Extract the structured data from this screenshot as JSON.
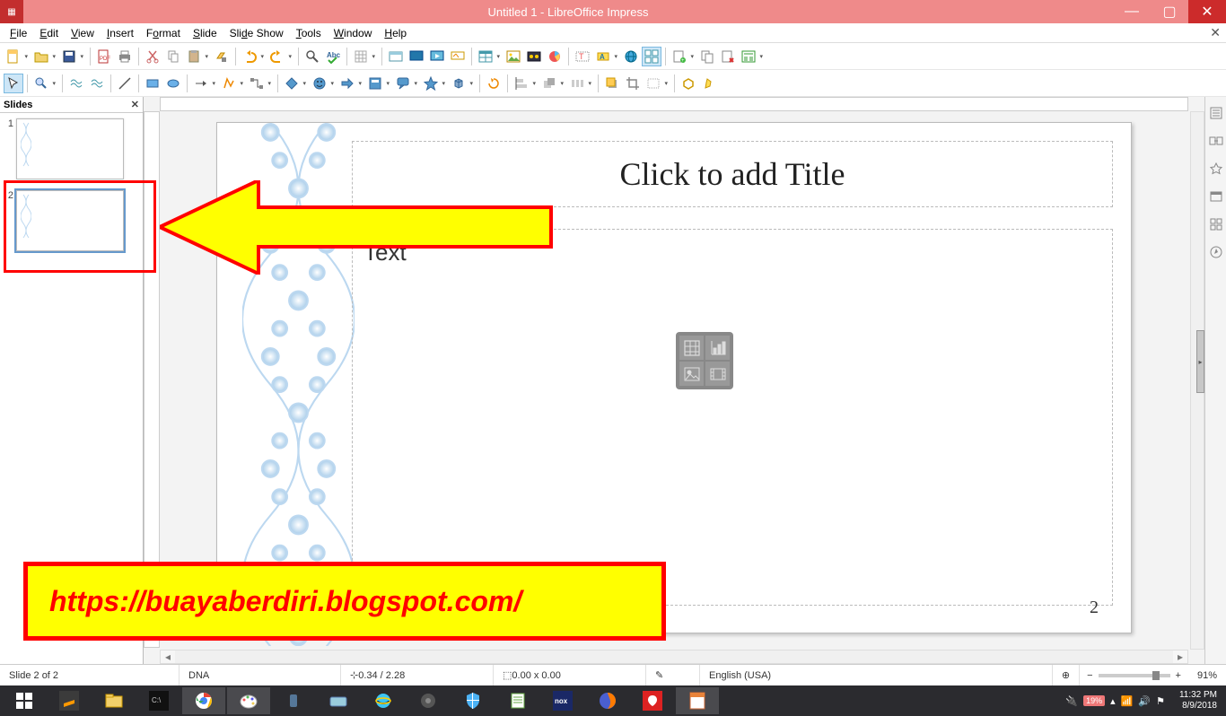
{
  "window": {
    "title": "Untitled 1 - LibreOffice Impress"
  },
  "menu": [
    "File",
    "Edit",
    "View",
    "Insert",
    "Format",
    "Slide",
    "Slide Show",
    "Tools",
    "Window",
    "Help"
  ],
  "slidepanel": {
    "title": "Slides",
    "thumbs": [
      {
        "num": "1"
      },
      {
        "num": "2"
      }
    ],
    "selected": 1
  },
  "slide": {
    "title_placeholder": "Click to add Title",
    "body_visible_text": "  Text",
    "page_number": "2"
  },
  "annotations": {
    "url": "https://buayaberdiri.blogspot.com/"
  },
  "statusbar": {
    "slide_info": "Slide 2 of 2",
    "template": "DNA",
    "cursor": "0.34 / 2.28",
    "objsize": "0.00 x 0.00",
    "language": "English (USA)",
    "zoom": "91%"
  },
  "system": {
    "battery": "19%",
    "time": "11:32 PM",
    "date": "8/9/2018"
  }
}
